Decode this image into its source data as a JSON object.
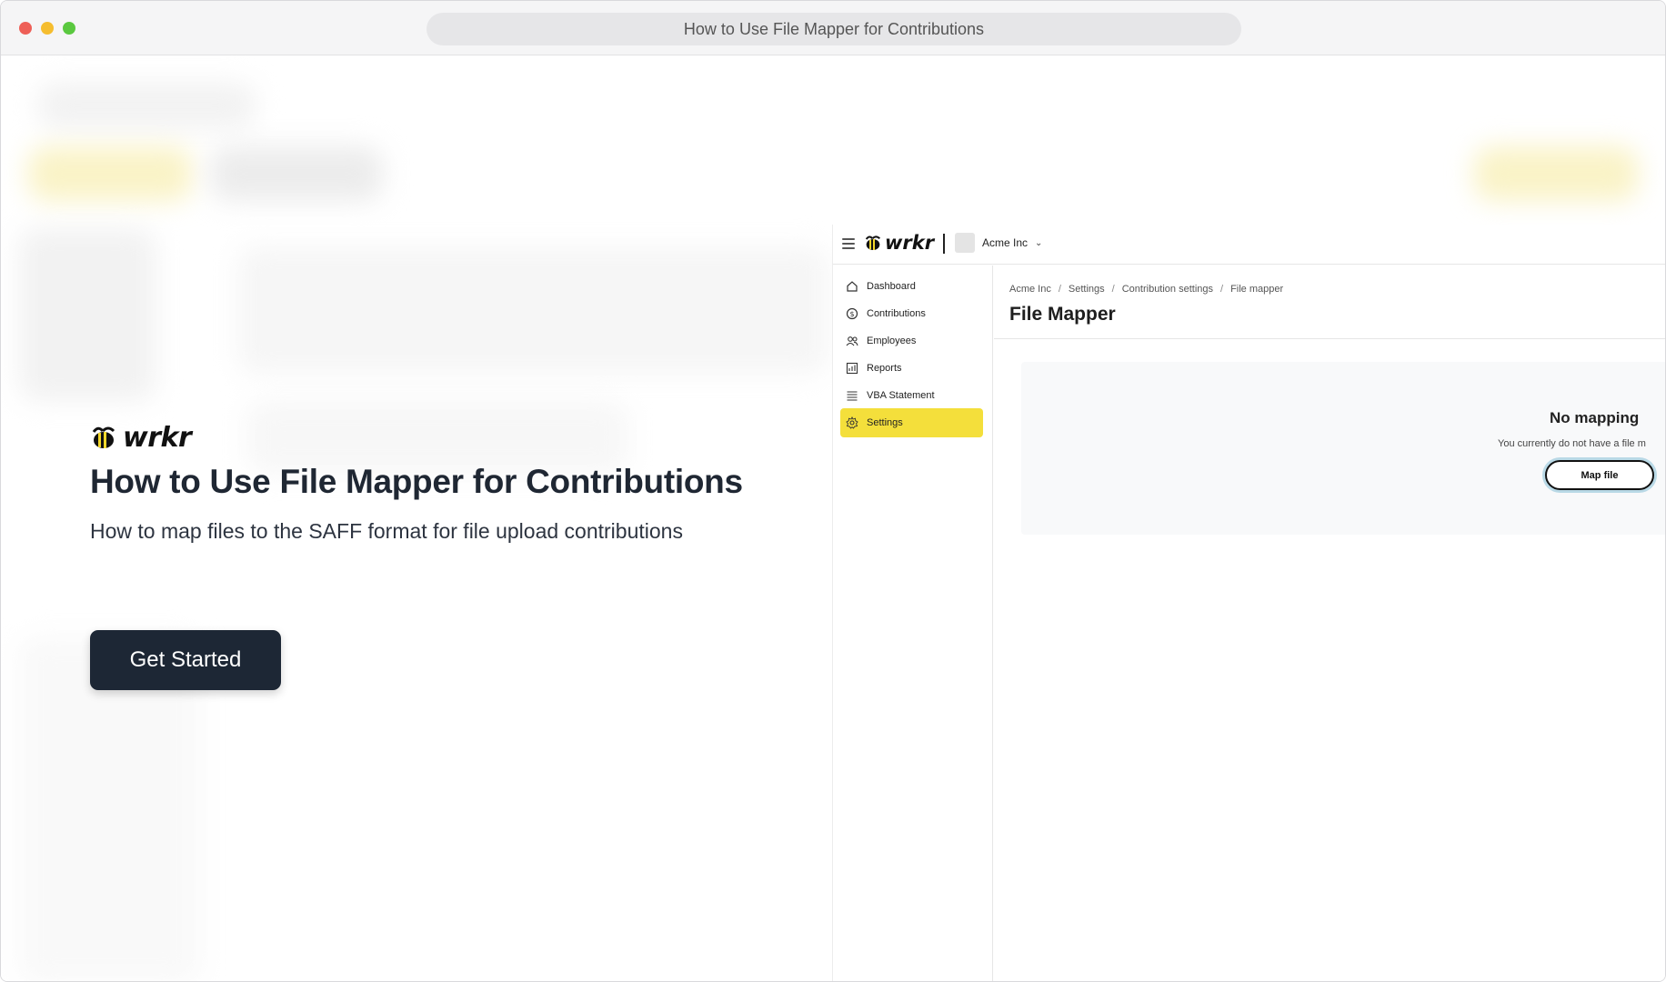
{
  "browser": {
    "url_title": "How to Use File Mapper for Contributions"
  },
  "hero": {
    "brand": "wrkr",
    "title": "How to Use File Mapper for Contributions",
    "subtitle": "How to map files to the SAFF format for file upload contributions",
    "cta_label": "Get Started"
  },
  "app": {
    "brand": "wrkr",
    "org_name": "Acme Inc",
    "sidebar": {
      "items": [
        {
          "label": "Dashboard",
          "icon": "home-icon"
        },
        {
          "label": "Contributions",
          "icon": "dollar-icon"
        },
        {
          "label": "Employees",
          "icon": "users-icon"
        },
        {
          "label": "Reports",
          "icon": "chart-icon"
        },
        {
          "label": "VBA Statement",
          "icon": "stack-icon"
        },
        {
          "label": "Settings",
          "icon": "gear-icon",
          "active": true
        }
      ]
    },
    "breadcrumb": [
      "Acme Inc",
      "Settings",
      "Contribution settings",
      "File mapper"
    ],
    "page_title": "File Mapper",
    "empty_state": {
      "title": "No mapping",
      "message": "You currently do not have a file m",
      "button": "Map file"
    },
    "colors": {
      "active_nav": "#f4df3b",
      "cta": "#1d2735"
    }
  }
}
